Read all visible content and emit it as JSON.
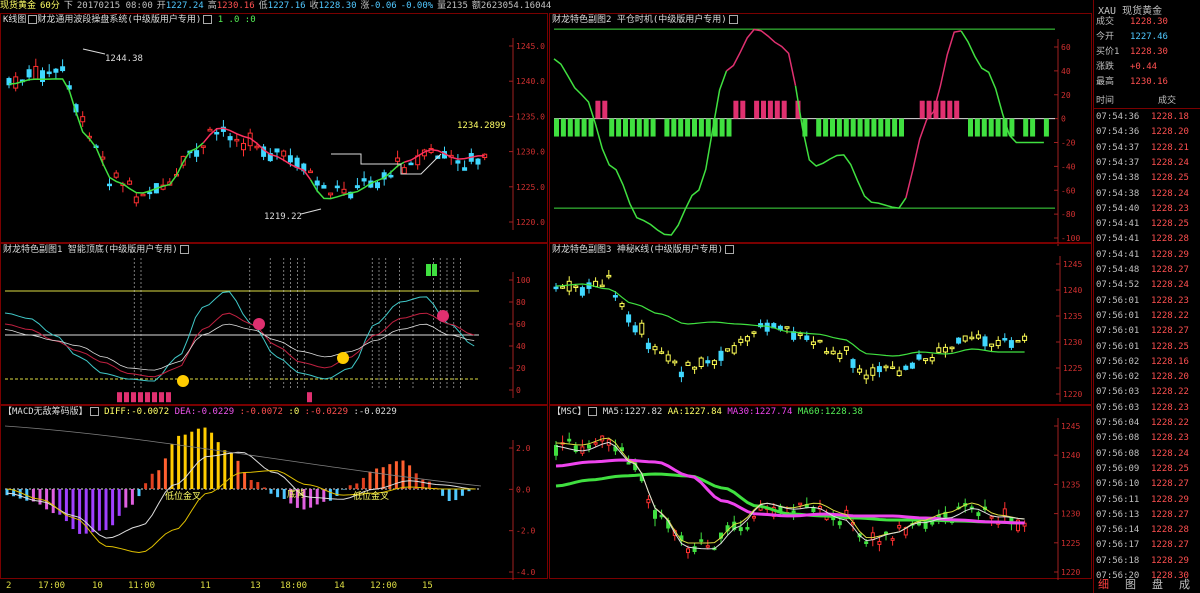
{
  "header": {
    "name": "现货黄金",
    "period": "60分",
    "arrow": "下",
    "datetime": "20170215 08:00",
    "open_label": "开",
    "open": "1227.24",
    "high_label": "高",
    "high": "1230.16",
    "low_label": "低",
    "low": "1227.16",
    "close_label": "收",
    "close": "1228.30",
    "change_label": "涨",
    "change": "-0.06",
    "pct": "-0.00%",
    "vol_label": "量",
    "vol": "2135",
    "amt_label": "额",
    "amt": "2623054.16044"
  },
  "panels": {
    "p1": {
      "title": "K线图",
      "ind": "财龙通用波段操盘系统(中级版用户专用)",
      "params": "1 .0 :0",
      "axis": [
        "1245.0",
        "1240.0",
        "1235.0",
        "1230.0",
        "1225.0",
        "1220.0"
      ],
      "ann_high": "1244.38",
      "ann_low": "1219.22",
      "ann_last": "1234.2899"
    },
    "p2": {
      "title": "财龙特色副图2 平仓时机(中级版用户专用)",
      "axis": [
        "60",
        "40",
        "20",
        "0",
        "-20",
        "-40",
        "-60",
        "-80",
        "-100"
      ]
    },
    "p3": {
      "title": "财龙特色副图1 智能顶底(中级版用户专用)",
      "axis": [
        "100",
        "80",
        "60",
        "40",
        "20",
        "0"
      ]
    },
    "p4": {
      "title": "财龙特色副图3 神秘K线(中级版用户专用)",
      "axis": [
        "1245",
        "1240",
        "1235",
        "1230",
        "1225",
        "1220"
      ]
    },
    "p5": {
      "title": "【MACD无敌筹码版】",
      "diff_label": "DIFF",
      "diff": ":-0.0072",
      "dea_label": "DEA",
      "dea": ":-0.0229",
      "v3": ":-0.0072",
      "v4": ":0",
      "v5": ":-0.0229",
      "v6": ":-0.0229",
      "axis": [
        "2.0",
        "0.0",
        "-2.0",
        "-4.0"
      ],
      "signals": [
        "低位金叉",
        "底背",
        "低位金叉"
      ]
    },
    "p6": {
      "title": "【MSC】",
      "ma5_label": "MA5",
      "ma5": ":1227.82",
      "aa_label": "AA",
      "aa": ":1227.84",
      "ma30_label": "MA30",
      "ma30": ":1227.74",
      "ma60_label": "MA60",
      "ma60": ":1228.38",
      "axis": [
        "1245",
        "1240",
        "1235",
        "1230",
        "1225",
        "1220"
      ]
    }
  },
  "xaxis": [
    "2",
    "17:00",
    "10",
    "11:00",
    "11",
    "13",
    "18:00",
    "14",
    "12:00",
    "15"
  ],
  "side": {
    "code": "XAU",
    "name": "现货黄金",
    "quotes": [
      {
        "k": "成交",
        "v": "1228.30",
        "c": "#ff5050"
      },
      {
        "k": "今开",
        "v": "1227.46",
        "c": "#50c8ff"
      },
      {
        "k": "买价1",
        "v": "1228.30",
        "c": "#ff5050"
      },
      {
        "k": "涨跌",
        "v": "+0.44",
        "c": "#ff5050"
      },
      {
        "k": "最高",
        "v": "1230.16",
        "c": "#ff5050"
      }
    ],
    "tick_time_label": "时间",
    "tick_price_label": "成交",
    "ticks": [
      [
        "07:54:36",
        "1228.18"
      ],
      [
        "07:54:36",
        "1228.20"
      ],
      [
        "07:54:37",
        "1228.21"
      ],
      [
        "07:54:37",
        "1228.24"
      ],
      [
        "07:54:38",
        "1228.25"
      ],
      [
        "07:54:38",
        "1228.24"
      ],
      [
        "07:54:40",
        "1228.23"
      ],
      [
        "07:54:41",
        "1228.25"
      ],
      [
        "07:54:41",
        "1228.28"
      ],
      [
        "07:54:41",
        "1228.29"
      ],
      [
        "07:54:48",
        "1228.27"
      ],
      [
        "07:54:52",
        "1228.24"
      ],
      [
        "07:56:01",
        "1228.23"
      ],
      [
        "07:56:01",
        "1228.22"
      ],
      [
        "07:56:01",
        "1228.27"
      ],
      [
        "07:56:01",
        "1228.25"
      ],
      [
        "07:56:02",
        "1228.16"
      ],
      [
        "07:56:02",
        "1228.20"
      ],
      [
        "07:56:03",
        "1228.22"
      ],
      [
        "07:56:03",
        "1228.23"
      ],
      [
        "07:56:04",
        "1228.22"
      ],
      [
        "07:56:08",
        "1228.23"
      ],
      [
        "07:56:08",
        "1228.24"
      ],
      [
        "07:56:09",
        "1228.25"
      ],
      [
        "07:56:10",
        "1228.27"
      ],
      [
        "07:56:11",
        "1228.29"
      ],
      [
        "07:56:13",
        "1228.27"
      ],
      [
        "07:56:14",
        "1228.28"
      ],
      [
        "07:56:17",
        "1228.27"
      ],
      [
        "07:56:18",
        "1228.29"
      ],
      [
        "07:56:20",
        "1228.30"
      ]
    ],
    "tabs": [
      "细",
      "图",
      "盘",
      "成"
    ]
  }
}
